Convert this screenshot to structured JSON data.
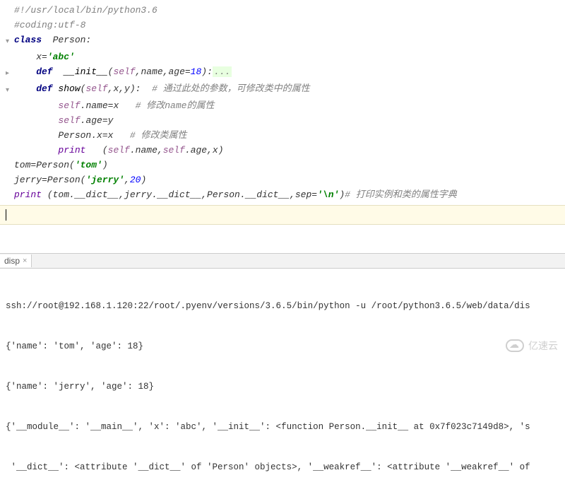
{
  "code": {
    "l1": "#!/usr/local/bin/python3.6",
    "l2": "#coding:utf-8",
    "l3_kw": "class",
    "l3_name": "  Person:",
    "l4_pre": "    x=",
    "l4_str": "'abc'",
    "l5_def": "    def",
    "l5_name": "  __init__",
    "l5_sig_open": "(",
    "l5_self": "self",
    "l5_sig_mid": ",name,age=",
    "l5_num": "18",
    "l5_sig_close": "):",
    "l5_dots": "...",
    "l6_def": "    def",
    "l6_name": " show",
    "l6_sig_open": "(",
    "l6_self": "self",
    "l6_sig_rest": ",x,y):",
    "l6_cmt": "  # 通过此处的参数，可修改类中的属性",
    "l7_pre": "        ",
    "l7_self": "self",
    "l7_rest": ".name=x",
    "l7_cmt": "   # 修改name的属性",
    "l8_pre": "        ",
    "l8_self": "self",
    "l8_rest": ".age=y",
    "l9_pre": "        Person.x=x",
    "l9_cmt": "   # 修改类属性",
    "l10_pre": "        ",
    "l10_print": "print",
    "l10_open": "   (",
    "l10_self1": "self",
    "l10_mid1": ".name,",
    "l10_self2": "self",
    "l10_rest": ".age,x)",
    "l11_a": "tom=Person(",
    "l11_str": "'tom'",
    "l11_b": ")",
    "l12_a": "jerry=Person(",
    "l12_str": "'jerry'",
    "l12_b": ",",
    "l12_num": "20",
    "l12_c": ")",
    "l13_print": "print",
    "l13_a": " (tom.__dict__,jerry.__dict__,Person.__dict__,",
    "l13_sep": "sep",
    "l13_eq": "=",
    "l13_str": "'\\n'",
    "l13_b": ")",
    "l13_cmt": "# 打印实例和类的属性字典"
  },
  "tab": {
    "label": "disp",
    "close": "×"
  },
  "console": {
    "l1": "ssh://root@192.168.1.120:22/root/.pyenv/versions/3.6.5/bin/python -u /root/python3.6.5/web/data/dis",
    "l2": "{'name': 'tom', 'age': 18}",
    "l3": "{'name': 'jerry', 'age': 18}",
    "l4": "{'__module__': '__main__', 'x': 'abc', '__init__': <function Person.__init__ at 0x7f023c7149d8>, 's",
    "l5": " '__dict__': <attribute '__dict__' of 'Person' objects>, '__weakref__': <attribute '__weakref__' of"
  },
  "watermark": "亿速云"
}
